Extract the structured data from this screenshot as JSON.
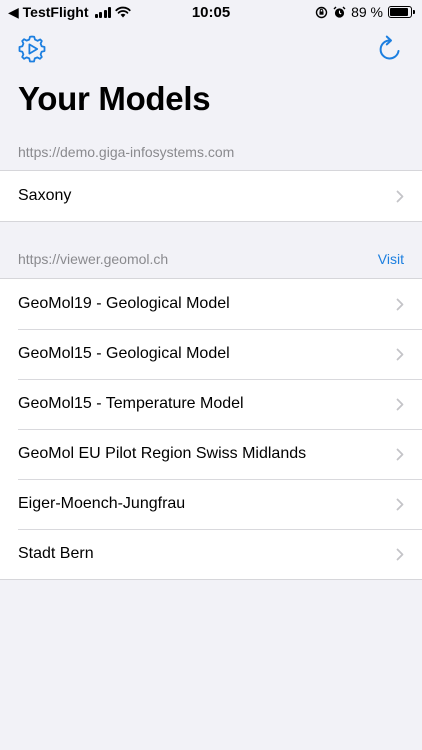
{
  "status_bar": {
    "back_label": "◀ TestFlight",
    "time": "10:05",
    "battery_text": "89 %",
    "battery_level": 0.89
  },
  "toolbar": {
    "settings_icon": "gear-play-icon",
    "refresh_icon": "refresh-icon",
    "accent_color": "#1c7fe0"
  },
  "page": {
    "title": "Your Models"
  },
  "sections": [
    {
      "header": "https://demo.giga-infosystems.com",
      "action": "",
      "rows": [
        {
          "label": "Saxony"
        }
      ]
    },
    {
      "header": "https://viewer.geomol.ch",
      "action": "Visit",
      "rows": [
        {
          "label": "GeoMol19 - Geological Model"
        },
        {
          "label": "GeoMol15 - Geological Model"
        },
        {
          "label": "GeoMol15 - Temperature Model"
        },
        {
          "label": "GeoMol EU Pilot Region Swiss Midlands"
        },
        {
          "label": "Eiger-Moench-Jungfrau"
        },
        {
          "label": "Stadt Bern"
        }
      ]
    }
  ]
}
